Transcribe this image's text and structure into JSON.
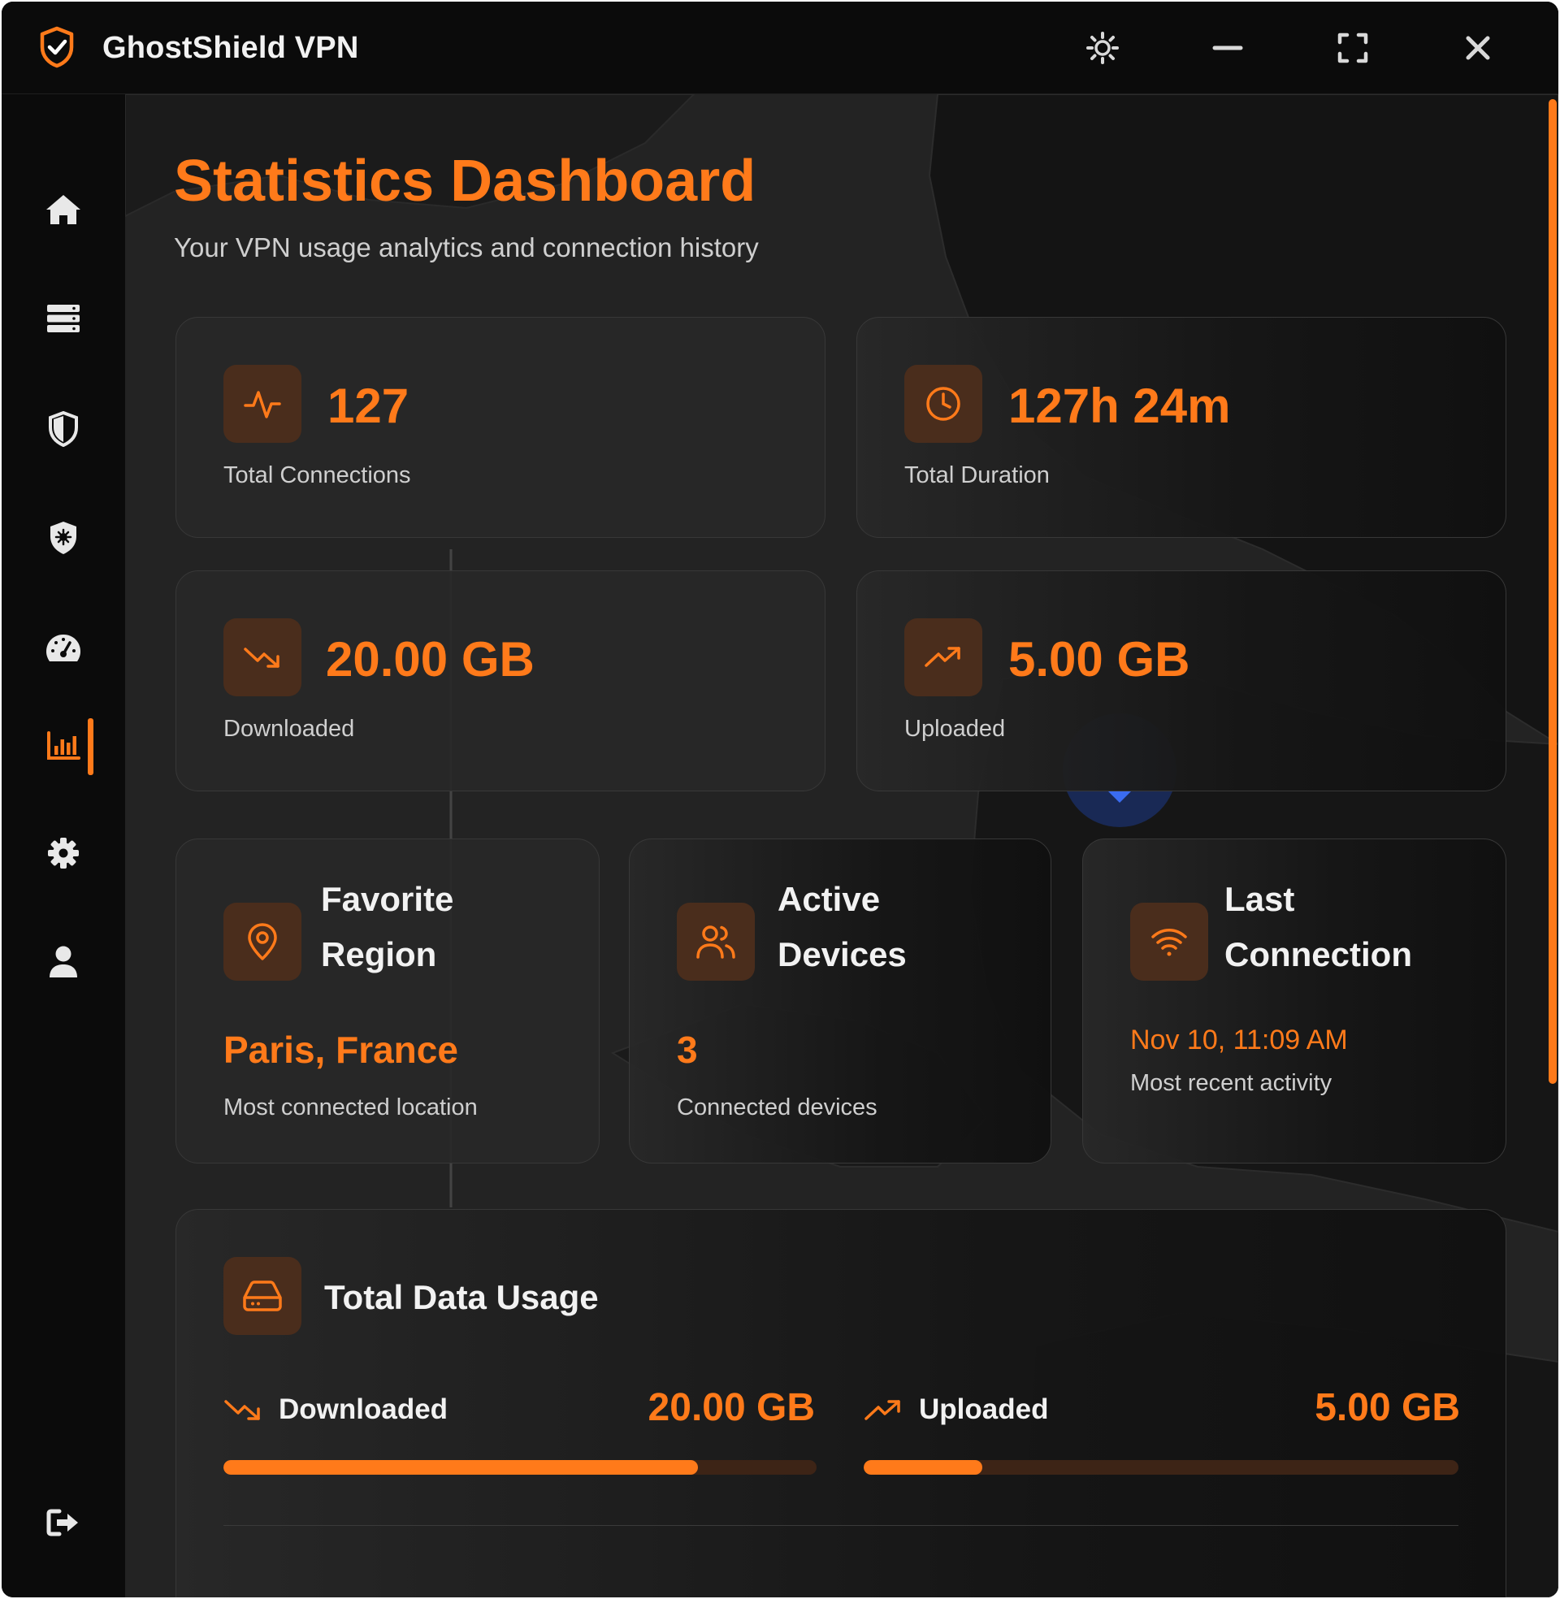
{
  "app": {
    "title": "GhostShield VPN"
  },
  "titlebar": {
    "buttons": [
      "gear-icon",
      "minimize-icon",
      "maximize-icon",
      "close-icon"
    ]
  },
  "sidebar": {
    "items": [
      {
        "icon": "home-icon"
      },
      {
        "icon": "server-list-icon"
      },
      {
        "icon": "shield-icon"
      },
      {
        "icon": "shield-virus-icon"
      },
      {
        "icon": "speedometer-icon"
      },
      {
        "icon": "bar-chart-icon",
        "active": true
      },
      {
        "icon": "settings-icon"
      },
      {
        "icon": "user-icon"
      },
      {
        "icon": "logout-icon"
      }
    ]
  },
  "page": {
    "title": "Statistics Dashboard",
    "subtitle": "Your VPN usage analytics and connection history"
  },
  "stats": {
    "total_connections": {
      "value": "127",
      "label": "Total Connections",
      "icon": "activity-icon"
    },
    "total_duration": {
      "value": "127h 24m",
      "label": "Total Duration",
      "icon": "clock-icon"
    },
    "downloaded": {
      "value": "20.00 GB",
      "label": "Downloaded",
      "icon": "trending-down-icon"
    },
    "uploaded": {
      "value": "5.00 GB",
      "label": "Uploaded",
      "icon": "trending-up-icon"
    }
  },
  "info_cards": {
    "favorite_region": {
      "heading_line1": "Favorite",
      "heading_line2": "Region",
      "value": "Paris, France",
      "label": "Most connected location",
      "icon": "map-pin-icon"
    },
    "active_devices": {
      "heading_line1": "Active",
      "heading_line2": "Devices",
      "value": "3",
      "label": "Connected devices",
      "icon": "users-icon"
    },
    "last_connection": {
      "heading_line1": "Last",
      "heading_line2": "Connection",
      "value": "Nov 10, 11:09 AM",
      "label": "Most recent activity",
      "icon": "wifi-icon"
    }
  },
  "usage": {
    "title": "Total Data Usage",
    "icon": "hard-drive-icon",
    "downloaded": {
      "label": "Downloaded",
      "value": "20.00 GB",
      "fraction": 0.8
    },
    "uploaded": {
      "label": "Uploaded",
      "value": "5.00 GB",
      "fraction": 0.2
    }
  },
  "colors": {
    "accent": "#ff7a1a",
    "icon_box": "#4a2d1c",
    "background": "#232323",
    "sidebar": "#0b0b0b"
  }
}
